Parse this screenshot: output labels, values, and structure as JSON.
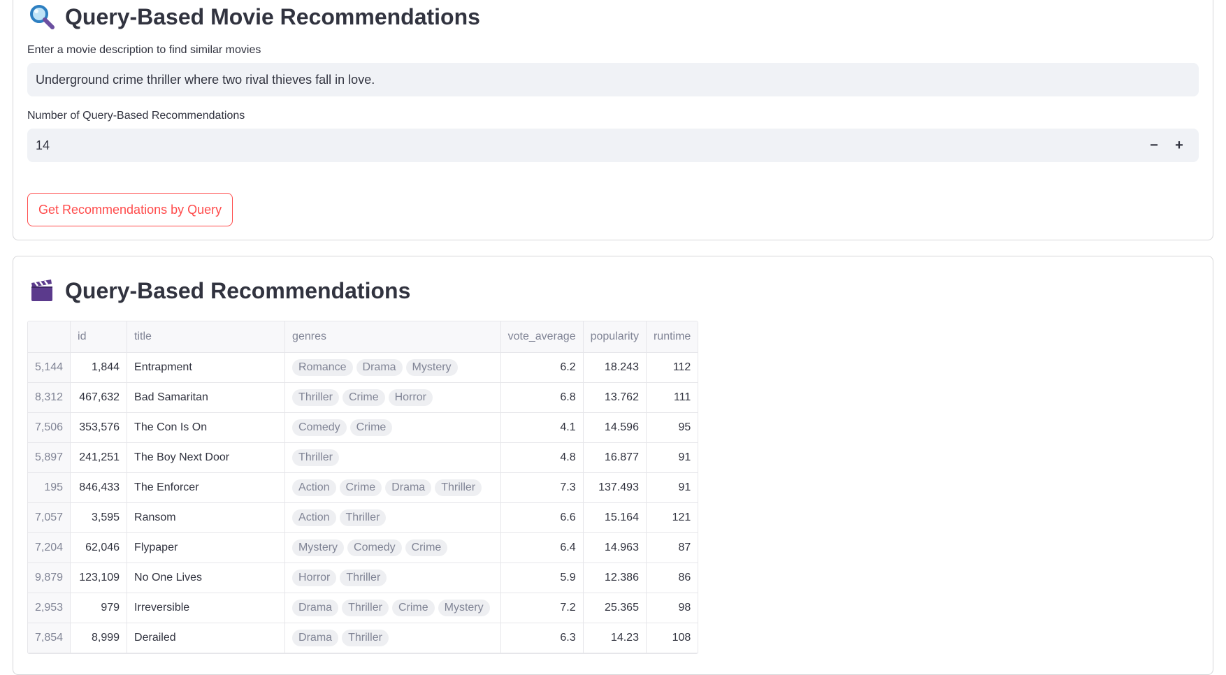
{
  "query_section": {
    "title": "Query-Based Movie Recommendations",
    "icon": "magnifying-glass-icon",
    "description_label": "Enter a movie description to find similar movies",
    "description_value": "Underground crime thriller where two rival thieves fall in love.",
    "count_label": "Number of Query-Based Recommendations",
    "count_value": "14",
    "decrement_label": "−",
    "increment_label": "+",
    "submit_label": "Get Recommendations by Query",
    "accent_color": "#ff4b4b"
  },
  "results_section": {
    "title": "Query-Based Recommendations",
    "icon": "clapper-board-icon",
    "columns": [
      "",
      "id",
      "title",
      "genres",
      "vote_average",
      "popularity",
      "runtime"
    ],
    "rows": [
      {
        "index": "5,144",
        "id": "1,844",
        "title": "Entrapment",
        "genres": [
          "Romance",
          "Drama",
          "Mystery"
        ],
        "vote_average": "6.2",
        "popularity": "18.243",
        "runtime": "112"
      },
      {
        "index": "8,312",
        "id": "467,632",
        "title": "Bad Samaritan",
        "genres": [
          "Thriller",
          "Crime",
          "Horror"
        ],
        "vote_average": "6.8",
        "popularity": "13.762",
        "runtime": "111"
      },
      {
        "index": "7,506",
        "id": "353,576",
        "title": "The Con Is On",
        "genres": [
          "Comedy",
          "Crime"
        ],
        "vote_average": "4.1",
        "popularity": "14.596",
        "runtime": "95"
      },
      {
        "index": "5,897",
        "id": "241,251",
        "title": "The Boy Next Door",
        "genres": [
          "Thriller"
        ],
        "vote_average": "4.8",
        "popularity": "16.877",
        "runtime": "91"
      },
      {
        "index": "195",
        "id": "846,433",
        "title": "The Enforcer",
        "genres": [
          "Action",
          "Crime",
          "Drama",
          "Thriller"
        ],
        "vote_average": "7.3",
        "popularity": "137.493",
        "runtime": "91"
      },
      {
        "index": "7,057",
        "id": "3,595",
        "title": "Ransom",
        "genres": [
          "Action",
          "Thriller"
        ],
        "vote_average": "6.6",
        "popularity": "15.164",
        "runtime": "121"
      },
      {
        "index": "7,204",
        "id": "62,046",
        "title": "Flypaper",
        "genres": [
          "Mystery",
          "Comedy",
          "Crime"
        ],
        "vote_average": "6.4",
        "popularity": "14.963",
        "runtime": "87"
      },
      {
        "index": "9,879",
        "id": "123,109",
        "title": "No One Lives",
        "genres": [
          "Horror",
          "Thriller"
        ],
        "vote_average": "5.9",
        "popularity": "12.386",
        "runtime": "86"
      },
      {
        "index": "2,953",
        "id": "979",
        "title": "Irreversible",
        "genres": [
          "Drama",
          "Thriller",
          "Crime",
          "Mystery"
        ],
        "vote_average": "7.2",
        "popularity": "25.365",
        "runtime": "98"
      },
      {
        "index": "7,854",
        "id": "8,999",
        "title": "Derailed",
        "genres": [
          "Drama",
          "Thriller"
        ],
        "vote_average": "6.3",
        "popularity": "14.23",
        "runtime": "108"
      }
    ]
  }
}
